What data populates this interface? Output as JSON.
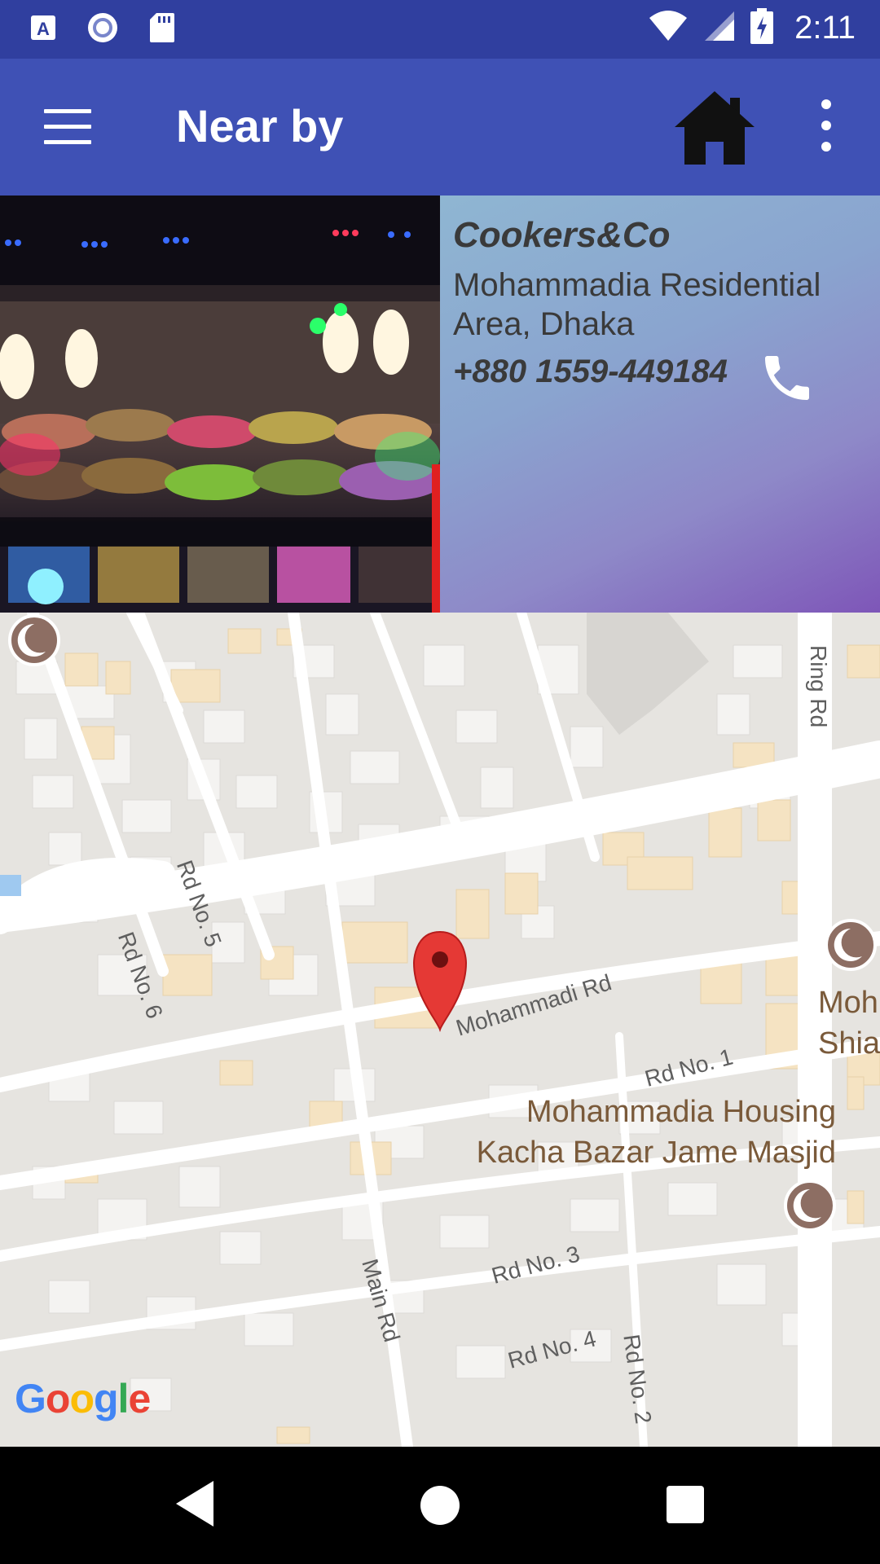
{
  "status_bar": {
    "time": "2:11",
    "left_icons": [
      "app-a-icon",
      "record-icon",
      "sd-card-icon"
    ],
    "right_icons": [
      "wifi-icon",
      "cell-signal-icon",
      "battery-charging-icon"
    ]
  },
  "app_bar": {
    "title": "Near by",
    "menu_icon": "hamburger-menu-icon",
    "home_icon": "home-icon",
    "overflow_icon": "more-vert-icon"
  },
  "place": {
    "name": "Cookers&Co",
    "address": "Mohammadia Residential Area, Dhaka",
    "phone": "+880 1559-449184",
    "call_icon": "phone-icon"
  },
  "map": {
    "street_labels": [
      "Ring Rd",
      "Rd No. 5",
      "Rd No. 6",
      "Mohammadi Rd",
      "Rd No. 1",
      "Main Rd",
      "Rd No. 3",
      "Rd No. 4",
      "Rd No. 2"
    ],
    "poi_labels": {
      "masjid": "Mohammadia Housing\nKacha Bazar Jame Masjid",
      "partial": "Moh\nShia"
    },
    "attribution": "Google",
    "marker_icon": "map-pin-icon",
    "mosque_icon": "mosque-icon"
  },
  "colors": {
    "status_bar": "#303F9F",
    "app_bar": "#3F51B5",
    "marker": "#E53935",
    "poi": "#8D6E63"
  },
  "nav_bar": {
    "icons": [
      "back-icon",
      "home-circle-icon",
      "recents-icon"
    ]
  }
}
